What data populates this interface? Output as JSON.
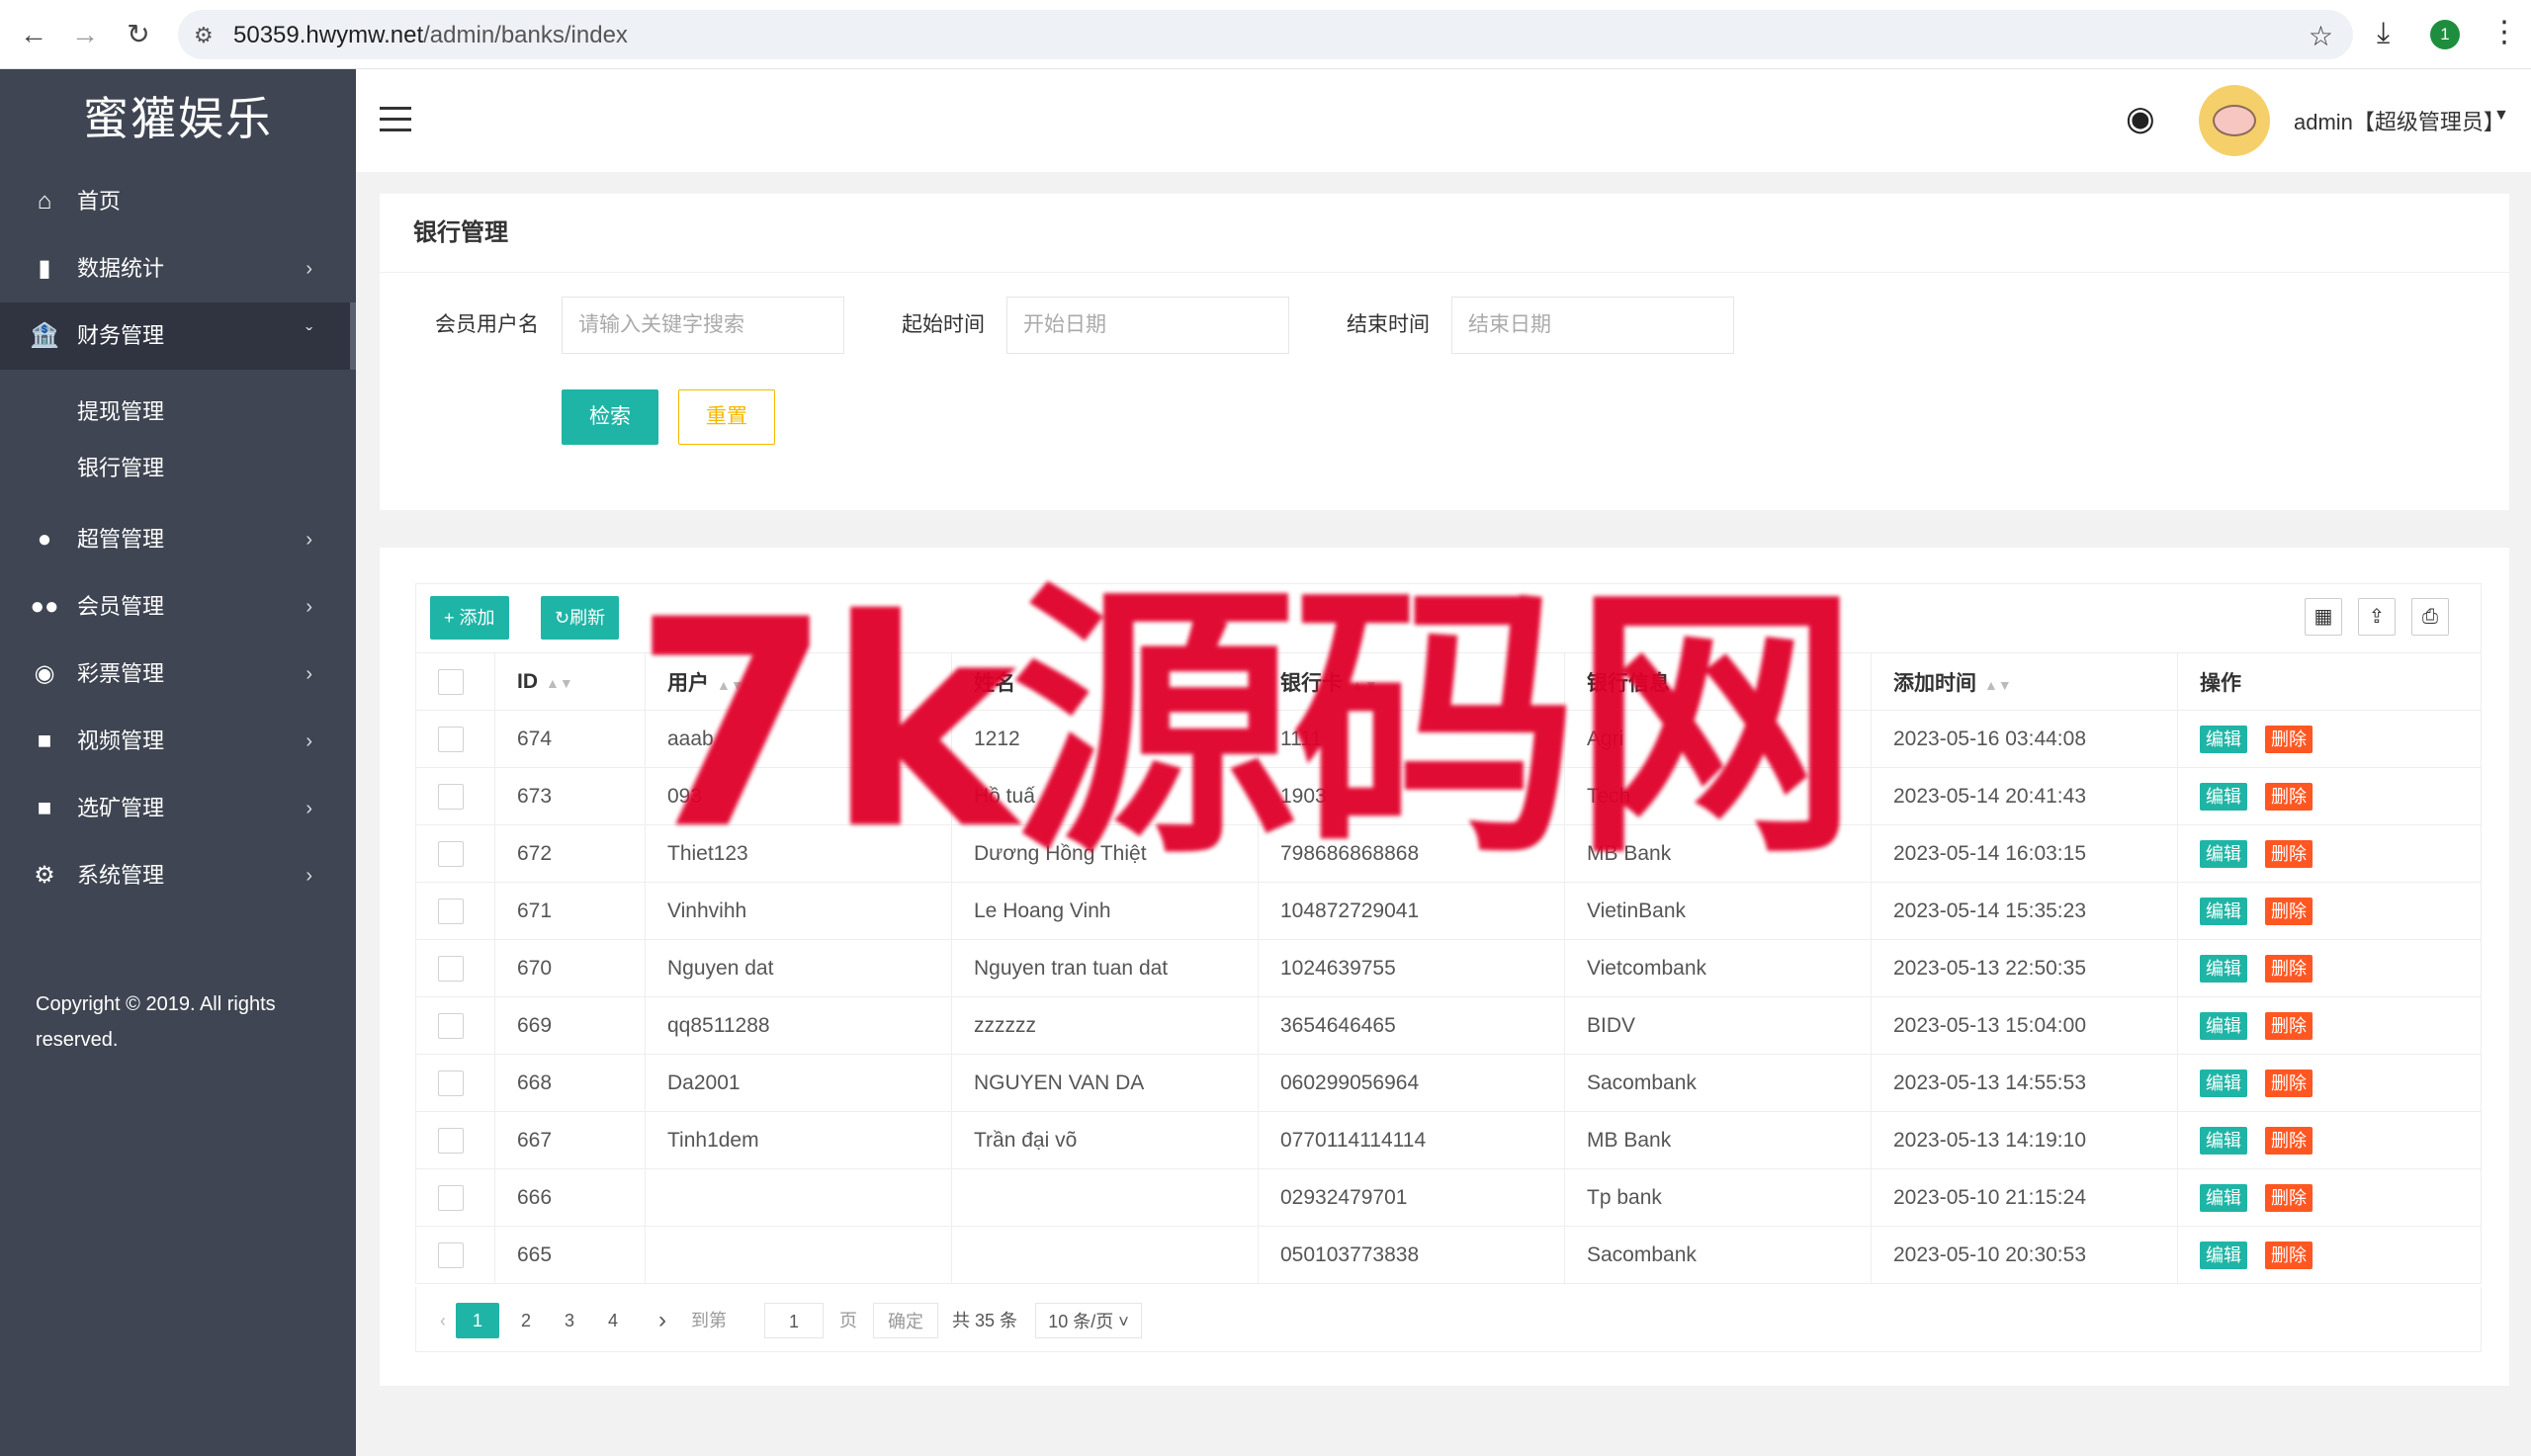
{
  "browser": {
    "url_host": "50359.hwymw.net",
    "url_path": "/admin/banks/index",
    "profile_badge": "1"
  },
  "sidebar": {
    "brand": "蜜獾娱乐",
    "items": [
      {
        "label": "首页",
        "icon": "home-icon"
      },
      {
        "label": "数据统计",
        "icon": "bar-chart-icon"
      },
      {
        "label": "财务管理",
        "icon": "bank-icon"
      },
      {
        "label": "超管管理",
        "icon": "user-icon"
      },
      {
        "label": "会员管理",
        "icon": "users-icon"
      },
      {
        "label": "彩票管理",
        "icon": "gamepad-icon"
      },
      {
        "label": "视频管理",
        "icon": "video-icon"
      },
      {
        "label": "选矿管理",
        "icon": "video-icon"
      },
      {
        "label": "系统管理",
        "icon": "gear-icon"
      }
    ],
    "sub_items": [
      {
        "label": "提现管理"
      },
      {
        "label": "银行管理"
      }
    ],
    "copyright": "Copyright © 2019. All rights reserved."
  },
  "header": {
    "user": "admin【超级管理员】"
  },
  "search": {
    "title": "银行管理",
    "username_label": "会员用户名",
    "username_placeholder": "请输入关键字搜索",
    "start_label": "起始时间",
    "start_placeholder": "开始日期",
    "end_label": "结束时间",
    "end_placeholder": "结束日期",
    "search_button": "检索",
    "reset_button": "重置"
  },
  "toolbar": {
    "add_label": "添加",
    "refresh_label": "刷新"
  },
  "table": {
    "columns": [
      "ID",
      "用户",
      "姓名",
      "银行卡",
      "银行信息",
      "添加时间",
      "操作"
    ],
    "edit_label": "编辑",
    "delete_label": "删除",
    "rows": [
      {
        "id": "674",
        "user": "aaab",
        "name": "1212",
        "card": "1111",
        "bank": "Agri",
        "time": "2023-05-16 03:44:08"
      },
      {
        "id": "673",
        "user": "093",
        "name": "Hồ tuấ",
        "card": "1903",
        "bank": "Tech",
        "time": "2023-05-14 20:41:43"
      },
      {
        "id": "672",
        "user": "Thiet123",
        "name": "Dương Hồng Thiệt",
        "card": "798686868868",
        "bank": "MB Bank",
        "time": "2023-05-14 16:03:15"
      },
      {
        "id": "671",
        "user": "Vinhvihh",
        "name": "Le Hoang Vinh",
        "card": "104872729041",
        "bank": "VietinBank",
        "time": "2023-05-14 15:35:23"
      },
      {
        "id": "670",
        "user": "Nguyen dat",
        "name": "Nguyen tran tuan dat",
        "card": "1024639755",
        "bank": "Vietcombank",
        "time": "2023-05-13 22:50:35"
      },
      {
        "id": "669",
        "user": "qq8511288",
        "name": "zzzzzz",
        "card": "3654646465",
        "bank": "BIDV",
        "time": "2023-05-13 15:04:00"
      },
      {
        "id": "668",
        "user": "Da2001",
        "name": "NGUYEN VAN DA",
        "card": "060299056964",
        "bank": "Sacombank",
        "time": "2023-05-13 14:55:53"
      },
      {
        "id": "667",
        "user": "Tinh1dem",
        "name": "Trần đại võ",
        "card": "0770114114114",
        "bank": "MB Bank",
        "time": "2023-05-13 14:19:10"
      },
      {
        "id": "666",
        "user": "",
        "name": "",
        "card": "02932479701",
        "bank": "Tp bank",
        "time": "2023-05-10 21:15:24"
      },
      {
        "id": "665",
        "user": "",
        "name": "",
        "card": "050103773838",
        "bank": "Sacombank",
        "time": "2023-05-10 20:30:53"
      }
    ]
  },
  "pager": {
    "pages": [
      "1",
      "2",
      "3",
      "4"
    ],
    "current": "1",
    "goto_label": "到第",
    "goto_value": "1",
    "page_unit": "页",
    "confirm": "确定",
    "total": "共 35 条",
    "per_page": "10 条/页"
  },
  "watermark": "7k源码网"
}
